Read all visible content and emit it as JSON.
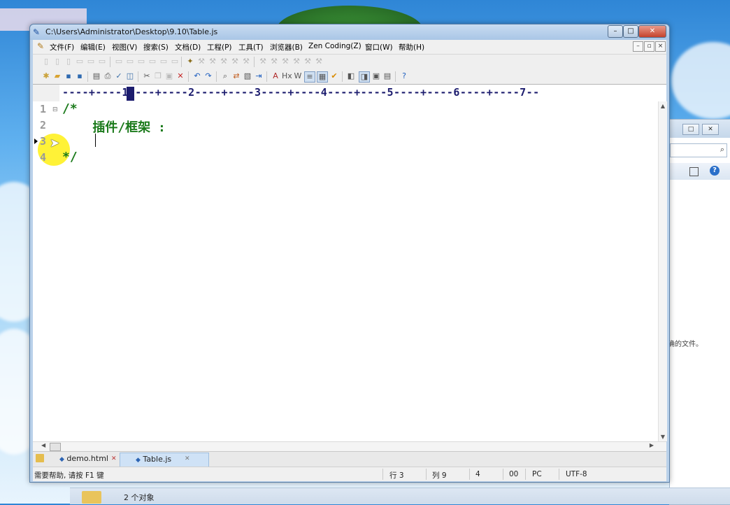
{
  "window": {
    "title": "C:\\Users\\Administrator\\Desktop\\9.10\\Table.js",
    "controls": {
      "minimize": "–",
      "maximize": "□",
      "close": "✕"
    }
  },
  "menu": {
    "items": [
      "文件(F)",
      "编辑(E)",
      "视图(V)",
      "搜索(S)",
      "文档(D)",
      "工程(P)",
      "工具(T)",
      "浏览器(B)",
      "Zen Coding(Z)",
      "窗口(W)",
      "帮助(H)"
    ],
    "mdi_controls": [
      "–",
      "▫",
      "×"
    ]
  },
  "ruler": {
    "text": "----+----1----+----2----+----3----+----4----+----5----+----6----+----7--"
  },
  "editor": {
    "line_numbers": [
      "1",
      "2",
      "3",
      "4"
    ],
    "lines": [
      "/*",
      "    插件/框架 :",
      "    ",
      "*/"
    ]
  },
  "tabs": [
    {
      "label": "demo.html",
      "active": false
    },
    {
      "label": "Table.js",
      "active": true
    }
  ],
  "status": {
    "help": "需要帮助, 请按 F1 键",
    "row": "行 3",
    "col": "列 9",
    "num": "4",
    "mode": "00",
    "line_ending": "PC",
    "encoding": "UTF-8"
  },
  "background_window": {
    "text": "确的文件。",
    "object_count": "2 个对象"
  },
  "colors": {
    "comment": "#1b7a1b",
    "ruler": "#1c1c6e",
    "titlebar": "#b9d1ea"
  }
}
